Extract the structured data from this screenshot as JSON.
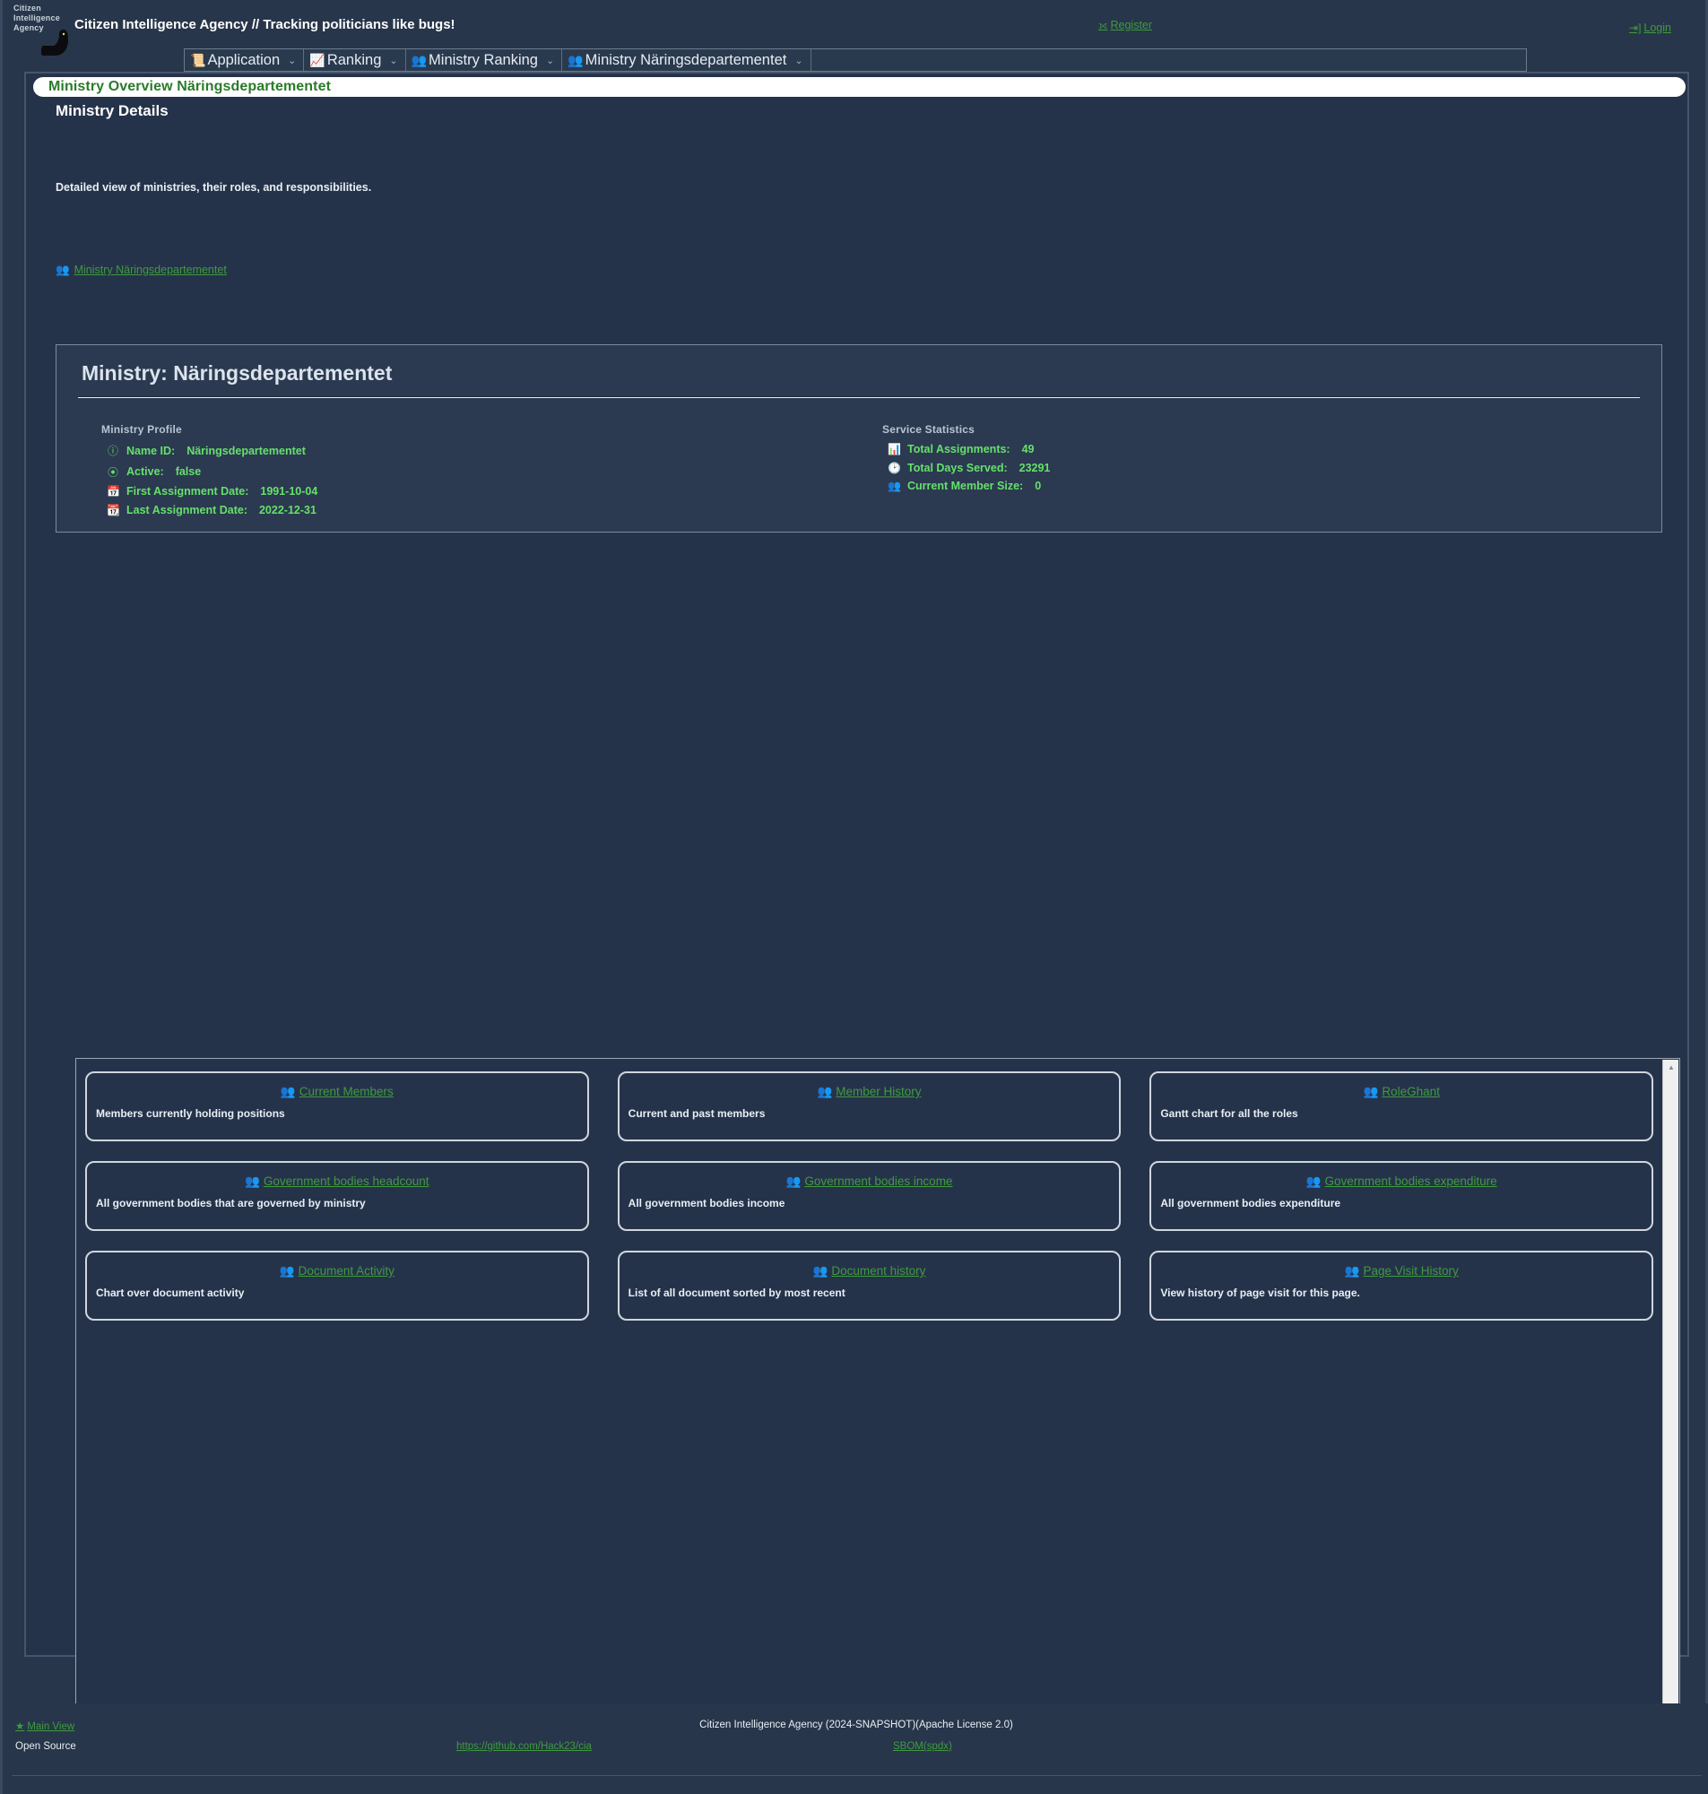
{
  "header": {
    "logo_lines": [
      "Citizen",
      "Intelligence",
      "Agency"
    ],
    "logo_icon": "swan-logo-icon",
    "brand": "Citizen Intelligence Agency  // Tracking politicians like bugs!",
    "register_label": "Register",
    "register_icon": "shuffle-icon",
    "login_label": "Login",
    "login_icon": "login-icon"
  },
  "menu": {
    "items": [
      {
        "label": "Application",
        "icon": "document-icon",
        "caret": "⌄"
      },
      {
        "label": "Ranking",
        "icon": "chart-line-icon",
        "caret": "⌄"
      },
      {
        "label": "Ministry Ranking",
        "icon": "people-icon",
        "caret": "⌄"
      },
      {
        "label": "Ministry Näringsdepartementet",
        "icon": "people-icon",
        "caret": "⌄"
      }
    ]
  },
  "page": {
    "title_bar": "Ministry Overview Näringsdepartementet",
    "section_heading": "Ministry Details",
    "section_description": "Detailed view of ministries, their roles, and responsibilities.",
    "breadcrumb": {
      "label": "Ministry Näringsdepartementet",
      "icon": "people-icon"
    }
  },
  "detail": {
    "heading": "Ministry: Näringsdepartementet",
    "profile": {
      "heading": "Ministry Profile",
      "rows": [
        {
          "icon": "info-icon",
          "label": "Name ID:",
          "value": "Näringsdepartementet"
        },
        {
          "icon": "bug-icon",
          "label": "Active:",
          "value": "false"
        },
        {
          "icon": "calendar-icon",
          "label": "First Assignment Date:",
          "value": "1991-10-04"
        },
        {
          "icon": "calendar-clock-icon",
          "label": "Last Assignment Date:",
          "value": "2022-12-31"
        }
      ]
    },
    "statistics": {
      "heading": "Service Statistics",
      "rows": [
        {
          "icon": "bar-chart-icon",
          "label": "Total Assignments:",
          "value": "49"
        },
        {
          "icon": "clock-icon",
          "label": "Total Days Served:",
          "value": "23291"
        },
        {
          "icon": "people-icon",
          "label": "Current Member Size:",
          "value": "0"
        }
      ]
    }
  },
  "cards": {
    "rows": [
      [
        {
          "icon": "people-icon",
          "title": "Current Members",
          "desc": "Members currently holding positions"
        },
        {
          "icon": "people-icon",
          "title": "Member History",
          "desc": "Current and past members"
        },
        {
          "icon": "people-icon",
          "title": "RoleGhant",
          "desc": "Gantt chart for all the roles"
        }
      ],
      [
        {
          "icon": "people-icon",
          "title": "Government bodies headcount",
          "desc": "All government bodies that are governed by ministry"
        },
        {
          "icon": "people-icon",
          "title": "Government bodies income",
          "desc": "All government bodies income"
        },
        {
          "icon": "people-icon",
          "title": "Government bodies expenditure",
          "desc": "All government bodies expenditure"
        }
      ],
      [
        {
          "icon": "people-icon",
          "title": "Document Activity",
          "desc": "Chart over document activity"
        },
        {
          "icon": "people-icon",
          "title": "Document history",
          "desc": "List of all document sorted by most recent"
        },
        {
          "icon": "people-icon",
          "title": "Page Visit History",
          "desc": "View history of page visit for this page."
        }
      ]
    ]
  },
  "footer": {
    "main_view": "Main View",
    "main_view_icon": "star-icon",
    "copyright": "Citizen Intelligence Agency (2024-SNAPSHOT)(Apache License 2.0)",
    "open_source": "Open Source",
    "github_url": "https://github.com/Hack23/cia",
    "sbom": "SBOM(spdx)"
  },
  "colors": {
    "accent_green": "#3f9b3f",
    "bright_green": "#66e06b",
    "background": "#25334a",
    "panel": "#2b3a50",
    "text": "#e9eef4"
  }
}
